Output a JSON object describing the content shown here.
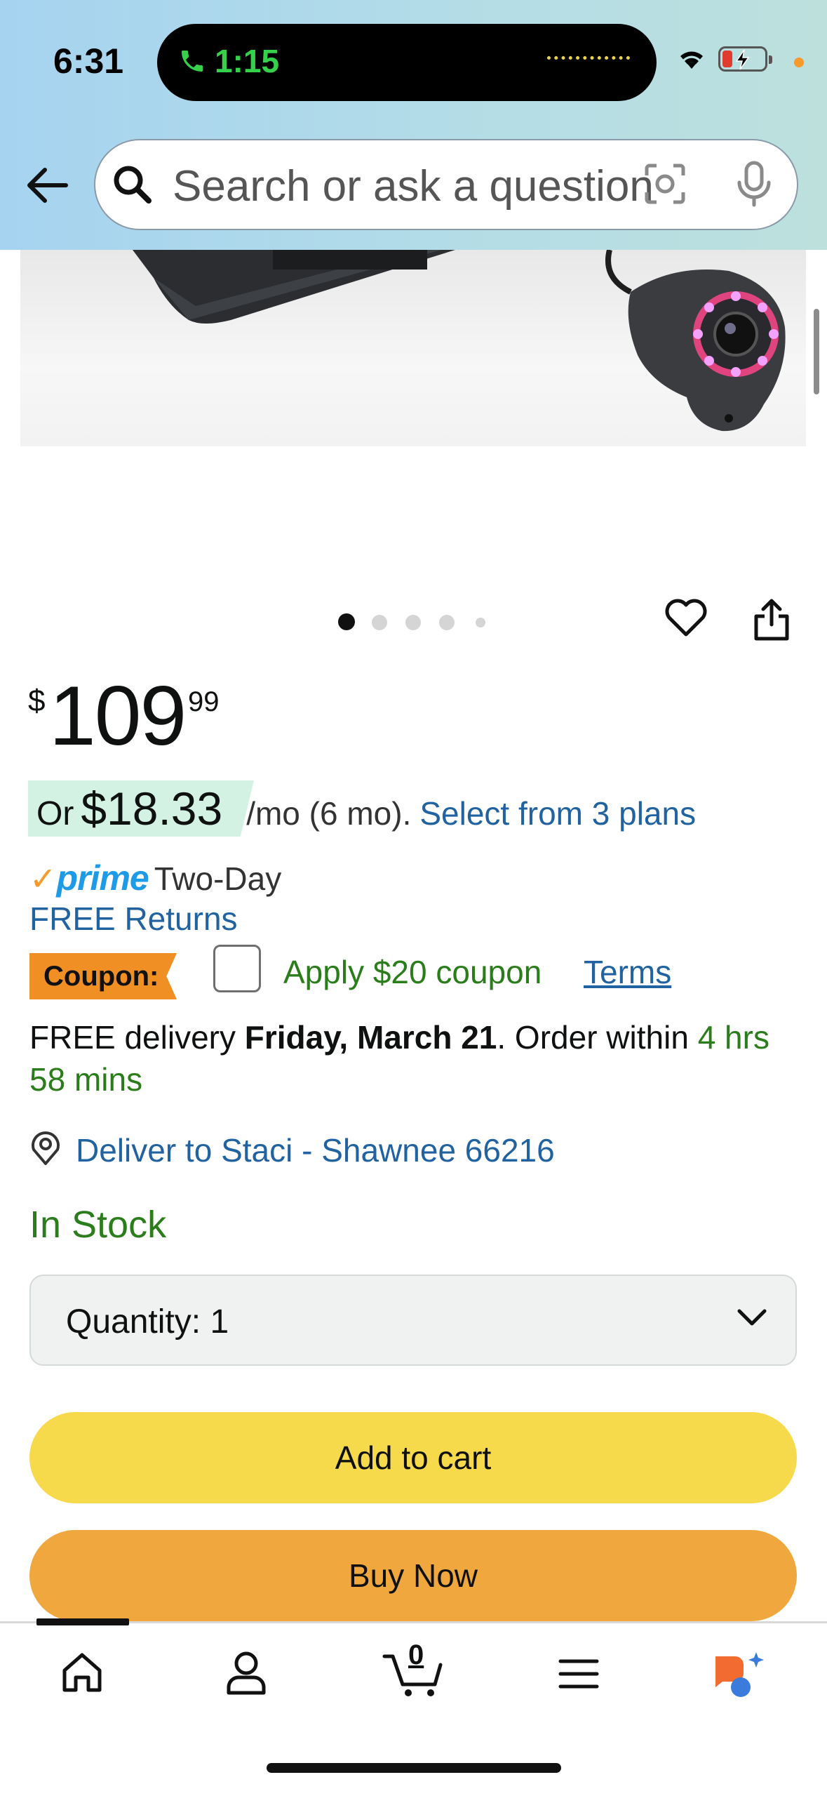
{
  "status_bar": {
    "time": "6:31",
    "call_duration": "1:15",
    "icons": [
      "phone-icon",
      "wifi-icon",
      "battery-charging-icon"
    ]
  },
  "header": {
    "search_placeholder": "Search or ask a question",
    "icons": [
      "back-arrow-icon",
      "search-icon",
      "camera-lens-icon",
      "microphone-icon"
    ]
  },
  "carousel": {
    "image_count": 5,
    "active_index": 0
  },
  "price": {
    "symbol": "$",
    "whole": "109",
    "fraction": "99",
    "monthly_prefix": "Or",
    "monthly_amount": "$18.33",
    "monthly_suffix": "/mo (6 mo).",
    "plans_link": "Select from 3 plans"
  },
  "prime": {
    "brand": "prime",
    "shipping": "Two-Day",
    "returns": "FREE Returns"
  },
  "coupon": {
    "badge": "Coupon:",
    "apply_text": "Apply $20 coupon",
    "terms_link": "Terms",
    "checked": false
  },
  "delivery": {
    "prefix": "FREE delivery",
    "date": "Friday, March 21",
    "order_text": ". Order within",
    "countdown": "4 hrs 58 mins"
  },
  "location": {
    "label": "Deliver to Staci - Shawnee 66216"
  },
  "stock": {
    "status": "In Stock"
  },
  "quantity": {
    "label": "Quantity:",
    "value": "1"
  },
  "buttons": {
    "add_to_cart": "Add to cart",
    "buy_now": "Buy Now"
  },
  "bottom_nav": {
    "cart_count": "0",
    "items": [
      "home-icon",
      "account-icon",
      "cart-icon",
      "menu-icon",
      "rufus-ai-icon"
    ]
  },
  "colors": {
    "link_blue": "#2162a1",
    "stock_green": "#2b7d1b",
    "add_to_cart_yellow": "#f7d94c",
    "buy_now_orange": "#f0a83e",
    "coupon_orange": "#f08f24",
    "prime_blue": "#1e9be6"
  }
}
